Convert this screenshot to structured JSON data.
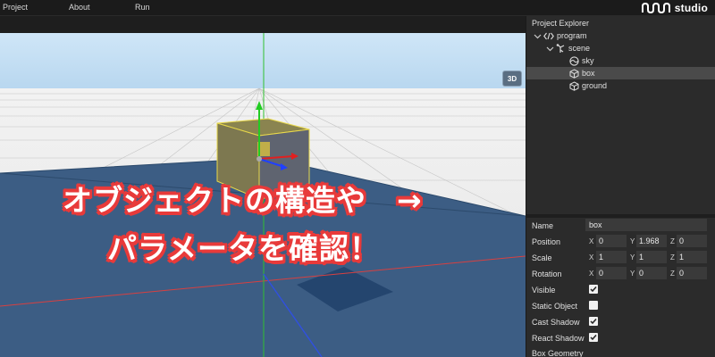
{
  "menu": {
    "project": "Project",
    "about": "About",
    "run": "Run"
  },
  "logo": {
    "text": "studio"
  },
  "viewport": {
    "view_button": "3D",
    "caption_line1": "オブジェクトの構造や　→",
    "caption_line2": "パラメータを確認！",
    "caption_color": "#e83a3a"
  },
  "explorer": {
    "title": "Project Explorer",
    "items": [
      {
        "label": "program",
        "icon": "code-icon"
      },
      {
        "label": "scene",
        "icon": "scene-icon"
      },
      {
        "label": "sky",
        "icon": "sky-icon"
      },
      {
        "label": "box",
        "icon": "box-icon"
      },
      {
        "label": "ground",
        "icon": "box-icon"
      }
    ],
    "selected": "box"
  },
  "properties": {
    "name_label": "Name",
    "name_value": "box",
    "position_label": "Position",
    "position": {
      "x": "0",
      "y": "1.968",
      "z": "0"
    },
    "scale_label": "Scale",
    "scale": {
      "x": "1",
      "y": "1",
      "z": "1"
    },
    "rotation_label": "Rotation",
    "rotation": {
      "x": "0",
      "y": "0",
      "z": "0"
    },
    "axis_x": "X",
    "axis_y": "Y",
    "axis_z": "Z",
    "visible_label": "Visible",
    "visible": true,
    "static_label": "Static Object",
    "static": false,
    "cast_shadow_label": "Cast Shadow",
    "cast_shadow": true,
    "react_shadow_label": "React Shadow",
    "react_shadow": true,
    "box_geometry_label": "Box Geometry"
  }
}
